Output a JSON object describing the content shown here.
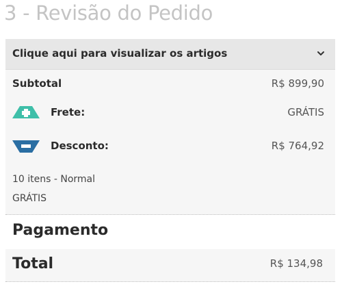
{
  "page": {
    "section_title": "3 - Revisão do Pedido"
  },
  "order_summary": {
    "toggle_label": "Clique aqui para visualizar os artigos",
    "subtotal_label": "Subtotal",
    "subtotal_value": "R$ 899,90",
    "shipping_label": "Frete:",
    "shipping_value": "GRÁTIS",
    "discount_label": "Desconto:",
    "discount_value": "R$ 764,92",
    "items_info": "10 itens - Normal",
    "items_shipping": "GRÁTIS"
  },
  "payment": {
    "label": "Pagamento"
  },
  "total": {
    "label": "Total",
    "value": "R$ 134,98"
  },
  "icons": {
    "shipping": "plus-arrow-up-icon",
    "discount": "minus-arrow-down-icon",
    "toggle": "chevron-down-icon"
  },
  "colors": {
    "shipping_icon": "#3fbfa9",
    "discount_icon": "#2a6ea3"
  }
}
